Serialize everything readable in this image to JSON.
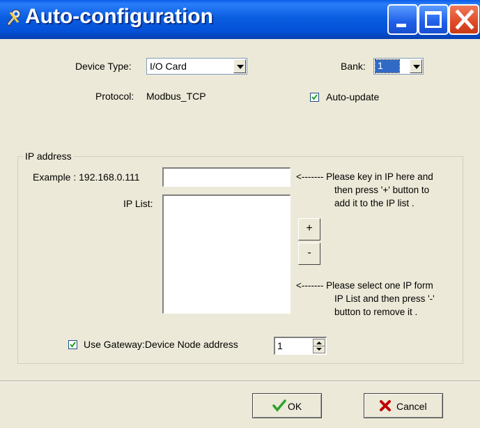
{
  "window": {
    "title": "Auto-configuration",
    "icon": "tools-icon",
    "controls": [
      "minimize-icon",
      "maximize-icon",
      "close-icon"
    ]
  },
  "device": {
    "type_label": "Device Type:",
    "type_value": "I/O Card",
    "protocol_label": "Protocol:",
    "protocol_value": "Modbus_TCP"
  },
  "bank": {
    "label": "Bank:",
    "value": "1"
  },
  "auto_update": {
    "label": "Auto-update",
    "checked": true
  },
  "ip_group": {
    "title": "IP address",
    "example_label": "Example : 192.168.0.111",
    "ip_input_value": "",
    "hint_add_line1": "<------- Please key in IP here and",
    "hint_add_line2": "then press '+' button to",
    "hint_add_line3": "add it to the IP list .",
    "list_label": "IP List:",
    "list_items": [],
    "add_label": "+",
    "remove_label": "-",
    "hint_remove_line1": "<------- Please select one IP form",
    "hint_remove_line2": "IP List and then press '-'",
    "hint_remove_line3": "button to remove it .",
    "gateway_label": "Use Gateway:Device Node address",
    "gateway_checked": true,
    "node_address": "1"
  },
  "buttons": {
    "ok_label": "OK",
    "cancel_label": "Cancel"
  },
  "colors": {
    "titlebar": "#0a5ce8",
    "close": "#e04a26",
    "ok_check": "#2ea02e",
    "cancel_x": "#c00000"
  }
}
